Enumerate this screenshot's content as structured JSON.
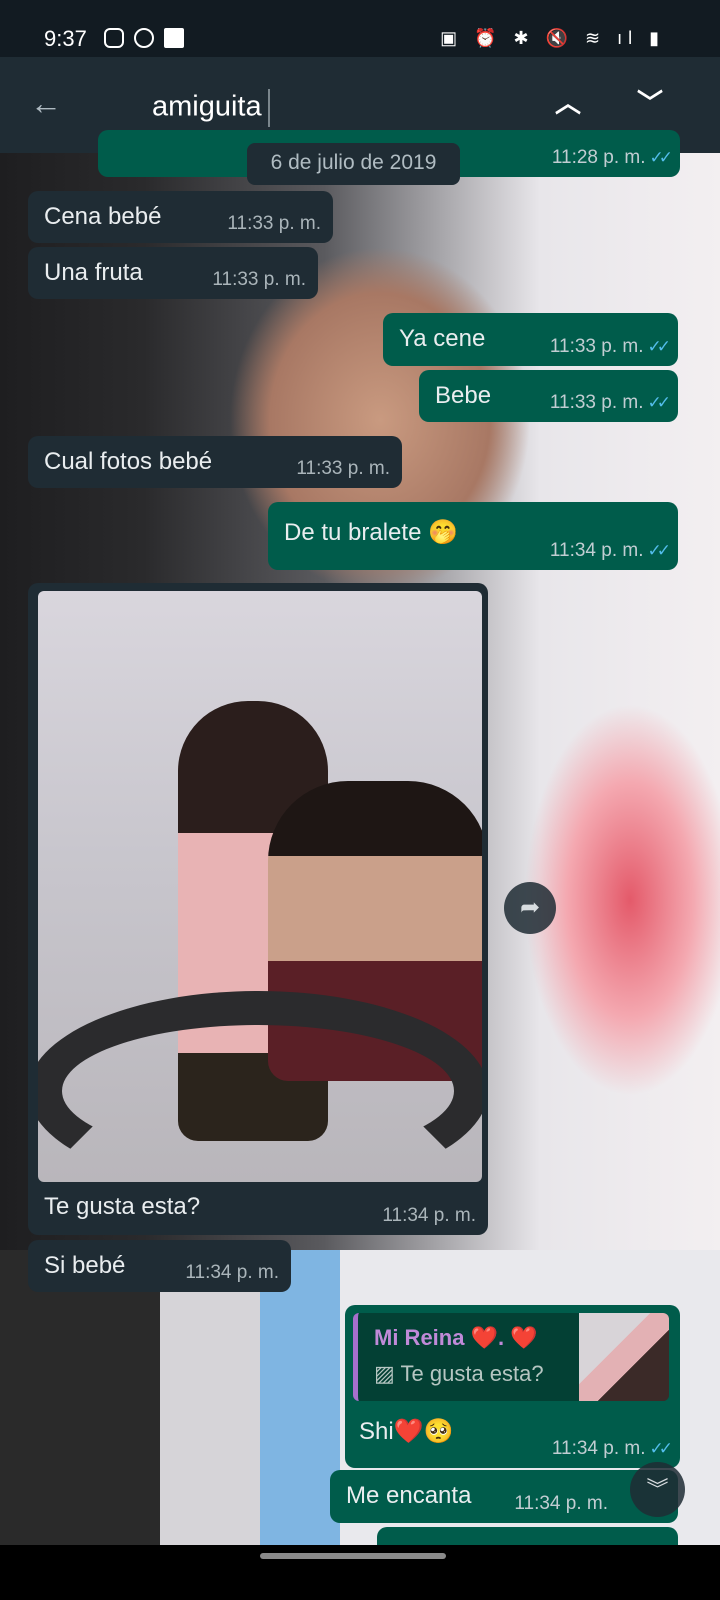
{
  "status_bar": {
    "time": "9:37",
    "left_icons": [
      "instagram-icon",
      "whatsapp-icon",
      "gallery-icon"
    ],
    "right_icons": [
      "battery-saver-icon",
      "alarm-icon",
      "bluetooth-icon",
      "mute-icon",
      "wifi-icon",
      "signal-icon",
      "battery-icon"
    ]
  },
  "toolbar": {
    "search_value": "amiguita",
    "up_label": "^",
    "down_label": "v"
  },
  "date_chip": "6 de julio de 2019",
  "messages": [
    {
      "dir": "out",
      "text": "",
      "time": "11:28 p. m."
    },
    {
      "dir": "in",
      "text": "Cena bebé",
      "time": "11:33 p. m."
    },
    {
      "dir": "in",
      "text": "Una fruta",
      "time": "11:33 p. m."
    },
    {
      "dir": "out",
      "text": "Ya cene",
      "time": "11:33 p. m."
    },
    {
      "dir": "out",
      "text": "Bebe",
      "time": "11:33 p. m."
    },
    {
      "dir": "in",
      "text": "Cual fotos bebé",
      "time": "11:33 p. m."
    },
    {
      "dir": "out",
      "text": "De tu bralete 🤭",
      "time": "11:34 p. m."
    },
    {
      "dir": "in",
      "type": "image",
      "text": "Te gusta esta?",
      "time": "11:34 p. m."
    },
    {
      "dir": "in",
      "text": "Si bebé",
      "time": "11:34 p. m."
    },
    {
      "dir": "out",
      "text": "Shi❤️🥺",
      "time": "11:34 p. m.",
      "reply": {
        "name": "Mi Reina ❤️. ❤️",
        "text": "Te gusta esta?"
      }
    },
    {
      "dir": "out",
      "text": "Me encanta",
      "time": "11:34 p. m."
    }
  ],
  "colors": {
    "incoming": "#1f2c34",
    "outgoing": "#005c4b",
    "tick": "#53bdeb",
    "reply_name": "#c08ad8"
  }
}
